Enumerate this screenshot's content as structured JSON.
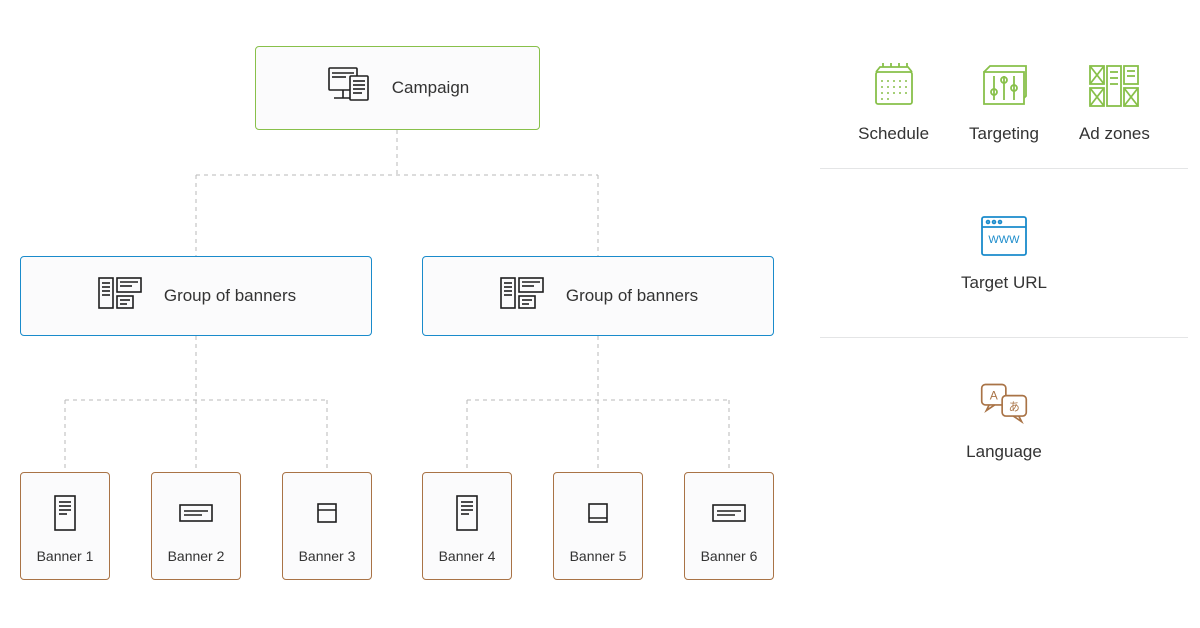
{
  "hierarchy": {
    "campaign": {
      "label": "Campaign"
    },
    "groups": [
      {
        "label": "Group of banners"
      },
      {
        "label": "Group of banners"
      }
    ],
    "banners": [
      {
        "label": "Banner 1"
      },
      {
        "label": "Banner 2"
      },
      {
        "label": "Banner 3"
      },
      {
        "label": "Banner 4"
      },
      {
        "label": "Banner 5"
      },
      {
        "label": "Banner 6"
      }
    ]
  },
  "side": {
    "row1": {
      "schedule": {
        "label": "Schedule"
      },
      "targeting": {
        "label": "Targeting"
      },
      "adzones": {
        "label": "Ad zones"
      }
    },
    "row2": {
      "target_url": {
        "label": "Target URL"
      }
    },
    "row3": {
      "language": {
        "label": "Language"
      }
    }
  },
  "colors": {
    "green": "#88c04a",
    "blue": "#1a8bcb",
    "brown": "#a97346",
    "ink": "#1f1f1f"
  }
}
